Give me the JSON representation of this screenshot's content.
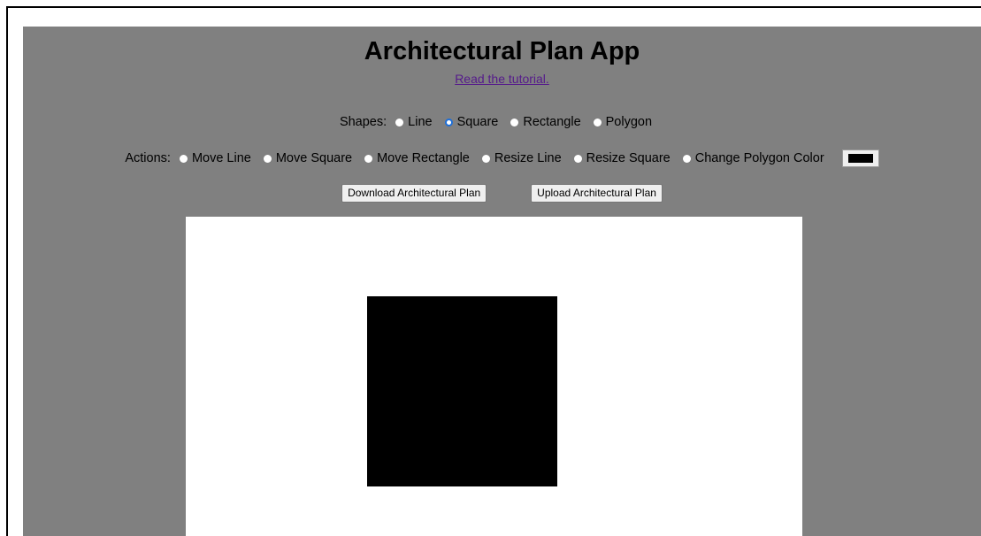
{
  "app": {
    "title": "Architectural Plan App",
    "tutorial_link": "Read the tutorial."
  },
  "shapes": {
    "label": "Shapes:",
    "selected": "Square",
    "options": [
      "Line",
      "Square",
      "Rectangle",
      "Polygon"
    ]
  },
  "actions": {
    "label": "Actions:",
    "options": [
      "Move Line",
      "Move Square",
      "Move Rectangle",
      "Resize Line",
      "Resize Square",
      "Change Polygon Color"
    ],
    "polygon_color": "#000000"
  },
  "buttons": {
    "download": "Download Architectural Plan",
    "upload": "Upload Architectural Plan"
  },
  "canvas": {
    "background": "#ffffff",
    "shapes": [
      {
        "type": "square",
        "fill": "#000000"
      }
    ]
  },
  "colors": {
    "app_background": "#808080",
    "link": "#551a8b",
    "radio_selected": "#1e6fd9"
  }
}
